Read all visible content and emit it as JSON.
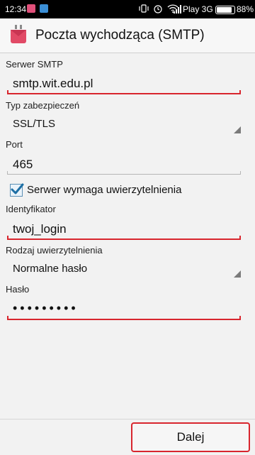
{
  "status_bar": {
    "time": "12:34",
    "carrier": "Play 3G",
    "battery_percent": "88%",
    "battery_level": 0.88,
    "icons": [
      "notification-app-icon",
      "notification-message-icon",
      "vibrate-icon",
      "alarm-icon",
      "wifi-icon",
      "signal-icon",
      "battery-icon"
    ]
  },
  "header": {
    "title": "Poczta wychodząca (SMTP)",
    "icon": "app-envelope-icon",
    "icon_color": "#e14a66"
  },
  "form": {
    "smtp_server": {
      "label": "Serwer SMTP",
      "value": "smtp.wit.edu.pl"
    },
    "security_type": {
      "label": "Typ zabezpieczeń",
      "value": "SSL/TLS"
    },
    "port": {
      "label": "Port",
      "value": "465"
    },
    "auth_required": {
      "label": "Serwer wymaga uwierzytelnienia",
      "checked": true
    },
    "username": {
      "label": "Identyfikator",
      "value": "twoj_login"
    },
    "auth_type": {
      "label": "Rodzaj uwierzytelnienia",
      "value": "Normalne hasło"
    },
    "password": {
      "label": "Hasło",
      "value_masked": "•••••••••"
    }
  },
  "footer": {
    "next_label": "Dalej"
  },
  "colors": {
    "error_underline": "#d8262e",
    "accent_check": "#1d6fa5"
  }
}
